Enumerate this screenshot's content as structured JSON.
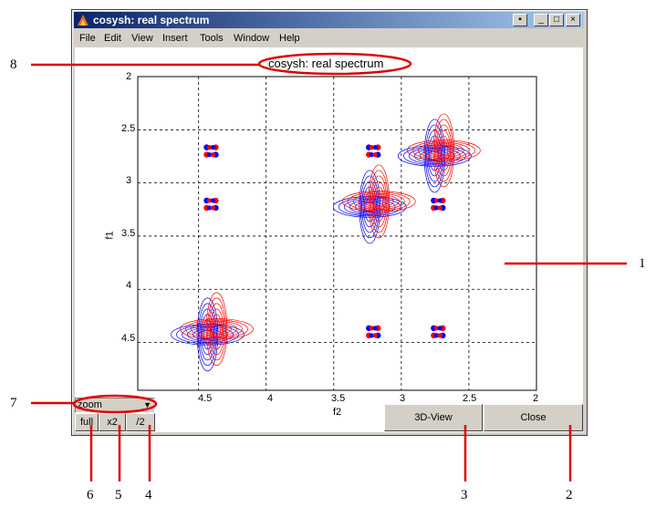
{
  "window": {
    "title": "cosysh: real spectrum"
  },
  "menu": [
    "File",
    "Edit",
    "View",
    "Insert",
    "Tools",
    "Window",
    "Help"
  ],
  "titlebar_buttons": {
    "extra": "▪",
    "minimize": "_",
    "maximize": "□",
    "close": "×"
  },
  "plot": {
    "title": "cosysh: real spectrum",
    "xlabel": "f2",
    "ylabel": "f1",
    "xticks": [
      "4.5",
      "4",
      "3.5",
      "3",
      "2.5",
      "2"
    ],
    "yticks": [
      "2",
      "2.5",
      "3",
      "3.5",
      "4",
      "4.5"
    ]
  },
  "chart_data": {
    "type": "contour",
    "title": "cosysh: real spectrum",
    "xlabel": "f2",
    "ylabel": "f1",
    "xlim": [
      4.95,
      2.0
    ],
    "ylim": [
      2.0,
      4.95
    ],
    "x_reversed": true,
    "y_reversed": true,
    "grid": true,
    "colors": {
      "positive": "#ff0000",
      "negative": "#0000ff"
    },
    "peaks": [
      {
        "x": 4.4,
        "y": 4.4,
        "kind": "diagonal",
        "size": "large"
      },
      {
        "x": 3.2,
        "y": 3.2,
        "kind": "diagonal",
        "size": "large"
      },
      {
        "x": 2.72,
        "y": 2.72,
        "kind": "diagonal",
        "size": "large"
      },
      {
        "x": 4.4,
        "y": 2.7,
        "kind": "cross",
        "size": "small"
      },
      {
        "x": 4.4,
        "y": 3.2,
        "kind": "cross",
        "size": "small"
      },
      {
        "x": 3.2,
        "y": 2.7,
        "kind": "cross",
        "size": "small"
      },
      {
        "x": 2.72,
        "y": 3.2,
        "kind": "cross",
        "size": "small"
      },
      {
        "x": 3.2,
        "y": 4.4,
        "kind": "cross",
        "size": "small"
      },
      {
        "x": 2.72,
        "y": 4.4,
        "kind": "cross",
        "size": "small"
      }
    ]
  },
  "controls": {
    "zoom_select": "zoom",
    "full": "full",
    "x2": "x2",
    "div2": "/2",
    "view3d": "3D-View",
    "close": "Close"
  },
  "callouts": [
    "1",
    "2",
    "3",
    "4",
    "5",
    "6",
    "7",
    "8"
  ],
  "colors": {
    "callout": "#e00000",
    "titlebar": "#0a246a"
  }
}
